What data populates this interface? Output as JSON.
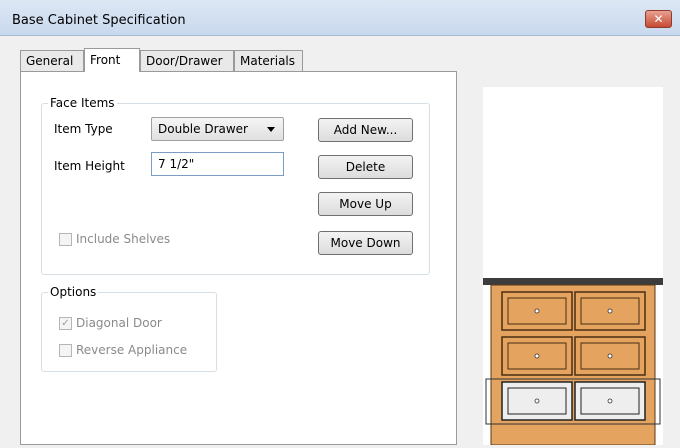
{
  "window": {
    "title": "Base Cabinet Specification",
    "close_glyph": "✕"
  },
  "tabs": [
    {
      "label": "General"
    },
    {
      "label": "Front"
    },
    {
      "label": "Door/Drawer"
    },
    {
      "label": "Materials"
    }
  ],
  "face_items": {
    "legend": "Face Items",
    "item_type_label": "Item Type",
    "item_type_value": "Double Drawer",
    "item_height_label": "Item Height",
    "item_height_value": "7 1/2\"",
    "add_new_label": "Add New...",
    "delete_label": "Delete",
    "move_up_label": "Move Up",
    "move_down_label": "Move Down",
    "include_shelves_label": "Include Shelves",
    "include_shelves_checked": false
  },
  "options": {
    "legend": "Options",
    "diagonal_door_label": "Diagonal Door",
    "diagonal_door_checked": true,
    "reverse_appliance_label": "Reverse Appliance",
    "reverse_appliance_checked": false
  },
  "preview": {
    "wood_color": "#e4a35f",
    "countertop_color": "#3c3c3c",
    "selected_drawer_color": "#eeeeee"
  }
}
